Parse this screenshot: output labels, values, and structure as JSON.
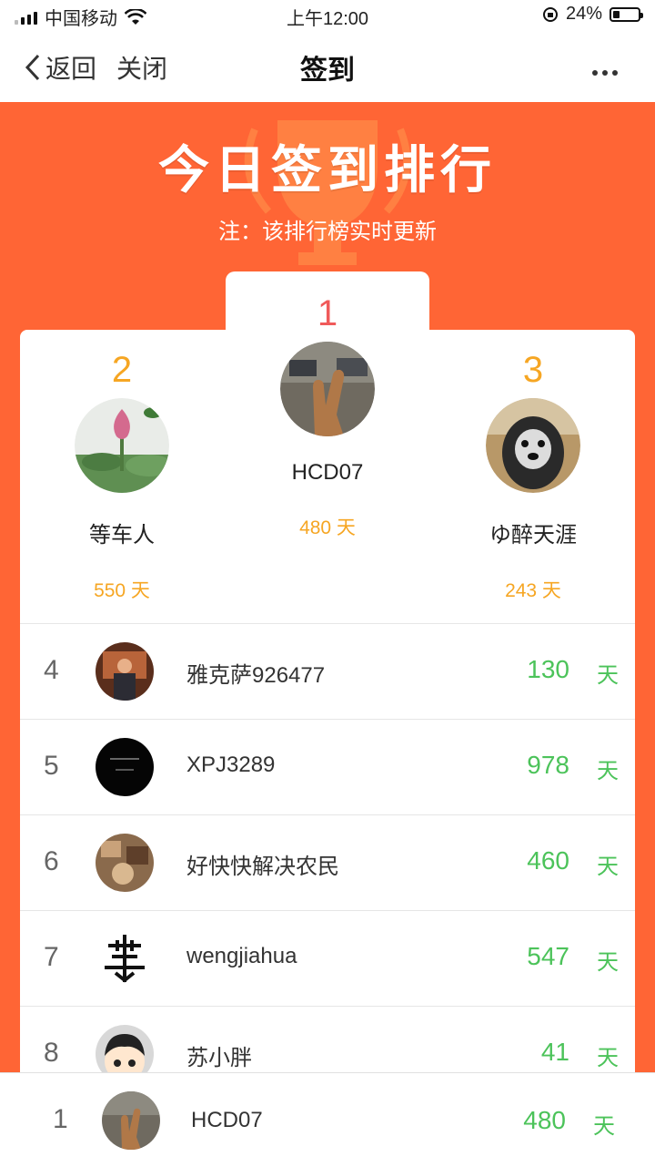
{
  "status_bar": {
    "carrier": "中国移动",
    "time": "上午12:00",
    "battery": "24%"
  },
  "nav": {
    "back_label": "返回",
    "close_label": "关闭",
    "title": "签到",
    "more_icon": "more-dots-icon"
  },
  "board": {
    "title": "今日签到排行",
    "note": "注：该排行榜实时更新"
  },
  "podium": {
    "first": {
      "rank": "1",
      "name": "HCD07",
      "days": "480 天"
    },
    "second": {
      "rank": "2",
      "name": "等车人",
      "days": "550 天"
    },
    "third": {
      "rank": "3",
      "name": "ゆ醉天涯",
      "days": "243 天"
    }
  },
  "list": [
    {
      "rank": "4",
      "name": "雅克萨926477",
      "days": "130",
      "unit": "天"
    },
    {
      "rank": "5",
      "name": "XPJ3289",
      "days": "978",
      "unit": "天"
    },
    {
      "rank": "6",
      "name": "好快快解决农民",
      "days": "460",
      "unit": "天"
    },
    {
      "rank": "7",
      "name": "wengjiahua",
      "days": "547",
      "unit": "天"
    },
    {
      "rank": "8",
      "name": "苏小胖",
      "days": "41",
      "unit": "天"
    }
  ],
  "my_rank": {
    "rank": "1",
    "name": "HCD07",
    "days": "480",
    "unit": "天"
  },
  "colors": {
    "board": "#ff6535",
    "gold": "#f6a623",
    "first": "#f05a5a",
    "green": "#4cc35a"
  }
}
